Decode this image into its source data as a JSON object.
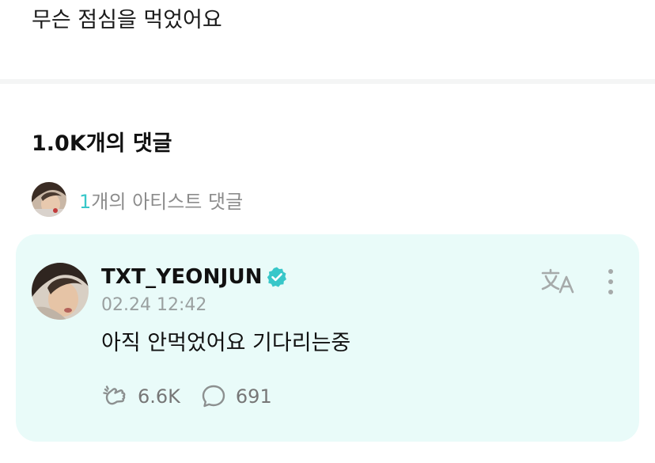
{
  "post": {
    "text": "무슨 점심을 먹었어요"
  },
  "comments": {
    "title": "1.0K개의 댓글",
    "artist_summary": {
      "count": "1",
      "label": "개의 아티스트 댓글"
    }
  },
  "comment": {
    "author": "TXT_YEONJUN",
    "verified_icon": "verified-badge-icon",
    "timestamp": "02.24 12:42",
    "body": "아직 안먹었어요 기다리는중",
    "likes": "6.6K",
    "replies": "691",
    "translate_icon": "translate-icon",
    "more_icon": "more-vertical-icon"
  },
  "colors": {
    "accent": "#38c7c9",
    "card_background": "#e9fbf9",
    "muted_text": "#8c8c8c",
    "icon_gray": "#9aa0a0"
  }
}
